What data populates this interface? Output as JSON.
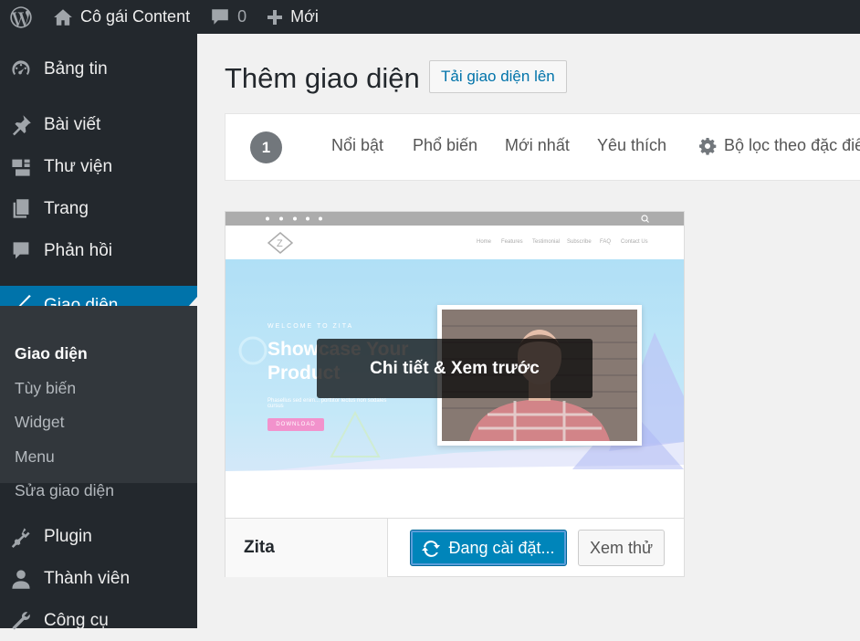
{
  "adminbar": {
    "site_name": "Cô gái Content",
    "comments_count": "0",
    "new_label": "Mới"
  },
  "sidebar": {
    "items": [
      {
        "label": "Bảng tin",
        "icon": "dashboard-icon"
      },
      {
        "label": "Bài viết",
        "icon": "pin-icon"
      },
      {
        "label": "Thư viện",
        "icon": "media-icon"
      },
      {
        "label": "Trang",
        "icon": "page-icon"
      },
      {
        "label": "Phản hồi",
        "icon": "comment-icon"
      },
      {
        "label": "Giao diện",
        "icon": "paintbrush-icon",
        "active": true
      },
      {
        "label": "Plugin",
        "icon": "plugin-icon"
      },
      {
        "label": "Thành viên",
        "icon": "user-icon"
      },
      {
        "label": "Công cụ",
        "icon": "wrench-icon"
      }
    ],
    "submenu": [
      "Giao diện",
      "Tùy biến",
      "Widget",
      "Menu",
      "Sửa giao diện"
    ]
  },
  "page": {
    "title": "Thêm giao diện",
    "upload_button": "Tải giao diện lên"
  },
  "filter": {
    "count": "1",
    "tabs": [
      "Nổi bật",
      "Phổ biến",
      "Mới nhất",
      "Yêu thích"
    ],
    "feature_filter": "Bộ lọc theo đặc điể"
  },
  "theme": {
    "name": "Zita",
    "details_overlay": "Chi tiết & Xem trước",
    "install_button": "Đang cài đặt...",
    "preview_button": "Xem thử",
    "screenshot": {
      "nav": [
        "Home",
        "Features",
        "Testimonial",
        "Subscribe",
        "FAQ",
        "Contact Us"
      ],
      "welcome": "WELCOME TO ZITA",
      "headline": "Showcase Your Product",
      "subtext": "Phasellus sed enim... porttitor lectus non sodales cursus",
      "cta": "DOWNLOAD"
    }
  },
  "colors": {
    "adminbar_bg": "#23282d",
    "active_menu": "#0073aa",
    "primary_button": "#0085ba",
    "hero_bg": "#9fd9f5"
  }
}
